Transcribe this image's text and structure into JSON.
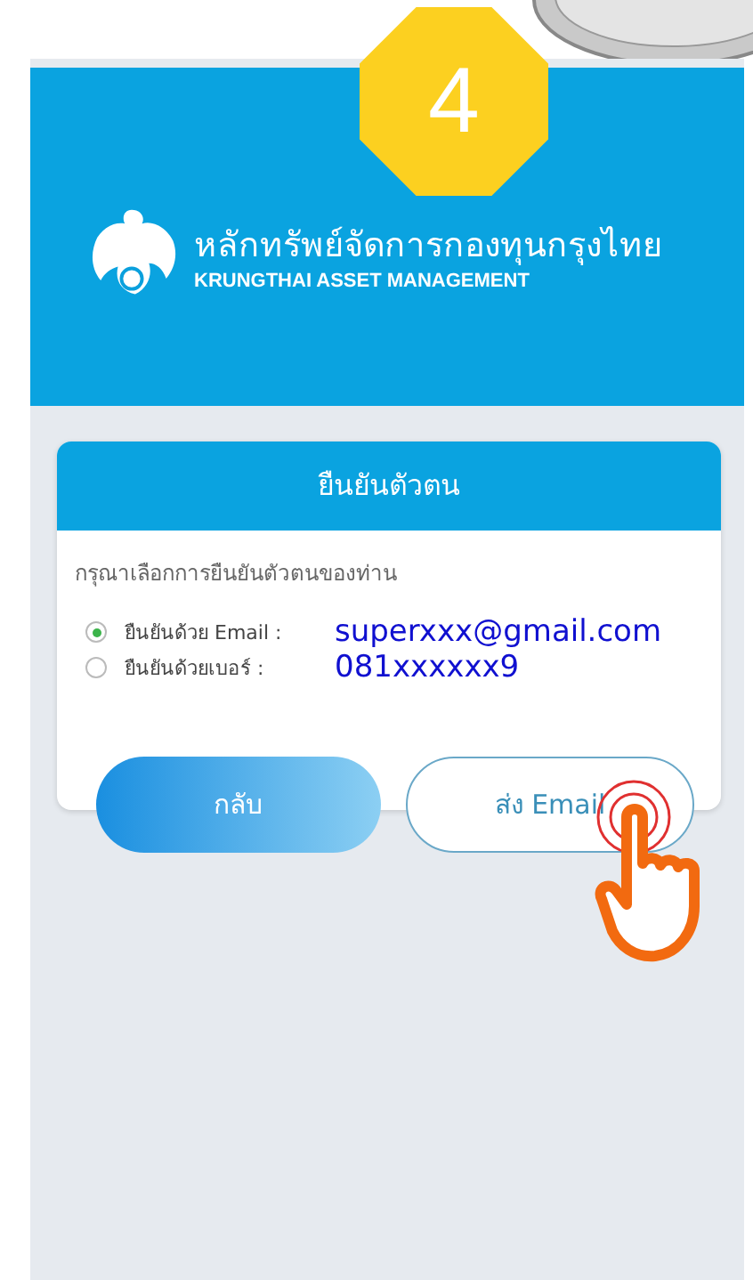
{
  "step_badge": "4",
  "brand": {
    "name_thai": "หลักทรัพย์จัดการกองทุนกรุงไทย",
    "name_english": "KRUNGTHAI ASSET MANAGEMENT"
  },
  "card": {
    "title": "ยืนยันตัวตน",
    "prompt": "กรุณาเลือกการยืนยันตัวตนของท่าน",
    "options": [
      {
        "label": "ยืนยันด้วย Email :",
        "value": "superxxx@gmail.com",
        "selected": true
      },
      {
        "label": "ยืนยันด้วยเบอร์ :",
        "value": "081xxxxxx9",
        "selected": false
      }
    ]
  },
  "buttons": [
    {
      "label": "กลับ",
      "kind": "primary"
    },
    {
      "label": "ส่ง Email",
      "kind": "outline"
    }
  ]
}
